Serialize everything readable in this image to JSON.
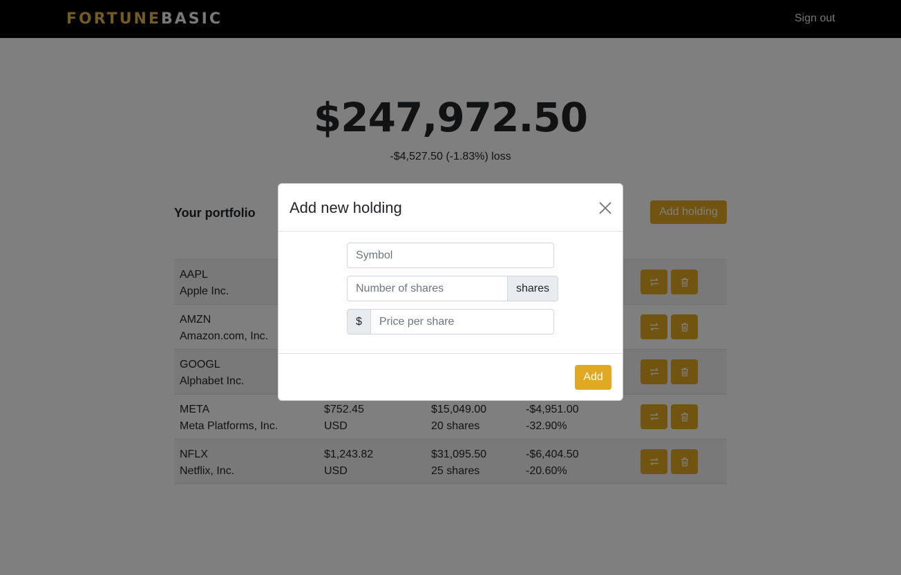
{
  "navbar": {
    "brand_part1": "FORTUNE",
    "brand_part2": "BASIC",
    "signout": "Sign out"
  },
  "summary": {
    "total": "$247,972.50",
    "change": "-$4,527.50 (-1.83%) loss"
  },
  "portfolio": {
    "title": "Your portfolio",
    "add_button": "Add holding",
    "holdings": [
      {
        "symbol": "AAPL",
        "name": "Apple Inc.",
        "price": "",
        "currency": "",
        "value": "",
        "shares": "",
        "gain": "",
        "gain_pct": ""
      },
      {
        "symbol": "AMZN",
        "name": "Amazon.com, Inc.",
        "price": "",
        "currency": "",
        "value": "",
        "shares": "",
        "gain": "",
        "gain_pct": ""
      },
      {
        "symbol": "GOOGL",
        "name": "Alphabet Inc.",
        "price": "",
        "currency": "",
        "value": "",
        "shares": "",
        "gain": "",
        "gain_pct": ""
      },
      {
        "symbol": "META",
        "name": "Meta Platforms, Inc.",
        "price": "$752.45",
        "currency": "USD",
        "value": "$15,049.00",
        "shares": "20 shares",
        "gain": "-$4,951.00",
        "gain_pct": "-32.90%"
      },
      {
        "symbol": "NFLX",
        "name": "Netflix, Inc.",
        "price": "$1,243.82",
        "currency": "USD",
        "value": "$31,095.50",
        "shares": "25 shares",
        "gain": "-$6,404.50",
        "gain_pct": "-20.60%"
      }
    ],
    "row_action_icons": [
      "swap-icon",
      "trash-icon"
    ]
  },
  "modal": {
    "title": "Add new holding",
    "symbol_placeholder": "Symbol",
    "shares_placeholder": "Number of shares",
    "shares_addon": "shares",
    "price_addon": "$",
    "price_placeholder": "Price per share",
    "submit": "Add"
  },
  "colors": {
    "accent": "#e1a821",
    "navbar": "#000000",
    "brand_gold": "#e4b64a"
  }
}
